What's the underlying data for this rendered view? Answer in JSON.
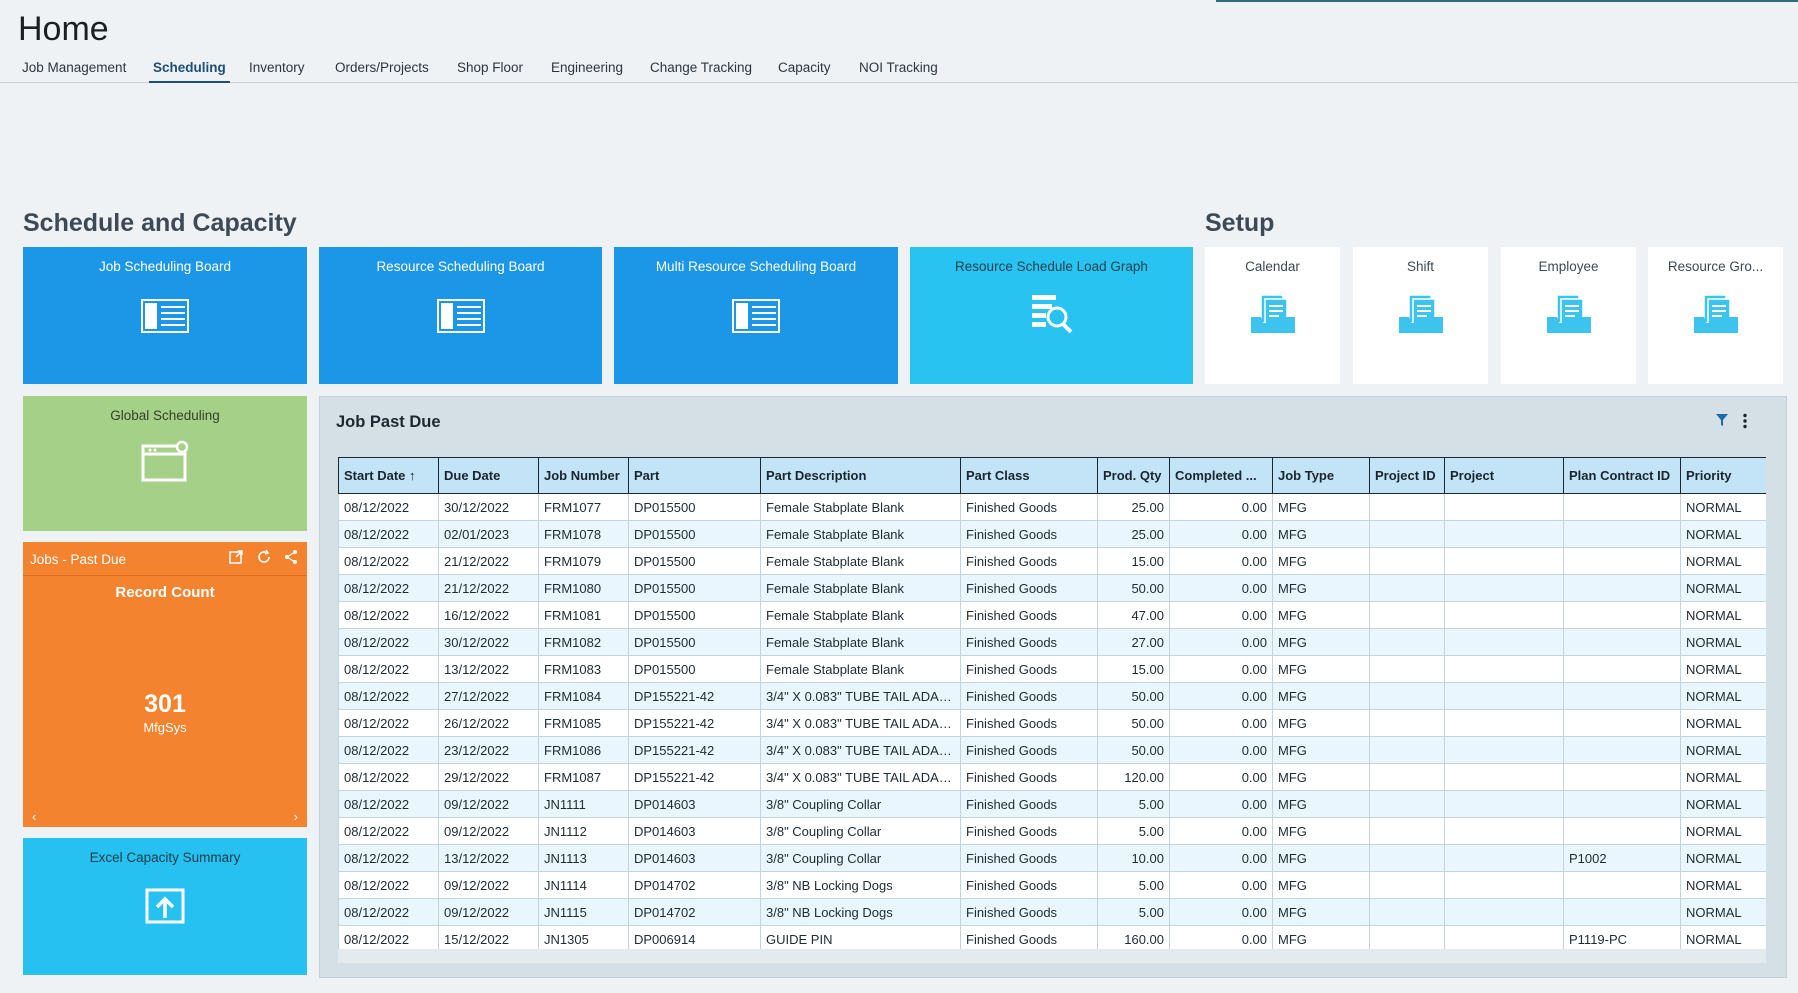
{
  "page": {
    "title": "Home"
  },
  "tabs": [
    {
      "label": "Job Management"
    },
    {
      "label": "Scheduling"
    },
    {
      "label": "Inventory"
    },
    {
      "label": "Orders/Projects"
    },
    {
      "label": "Shop Floor"
    },
    {
      "label": "Engineering"
    },
    {
      "label": "Change Tracking"
    },
    {
      "label": "Capacity"
    },
    {
      "label": "NOI Tracking"
    }
  ],
  "sections": {
    "schedule": "Schedule and Capacity",
    "setup": "Setup"
  },
  "tiles": {
    "job_board": "Job Scheduling Board",
    "resource_board": "Resource Scheduling Board",
    "multi_resource_board": "Multi Resource Scheduling Board",
    "load_graph": "Resource Schedule Load Graph",
    "calendar": "Calendar",
    "shift": "Shift",
    "employee": "Employee",
    "resource_group": "Resource Gro...",
    "global_scheduling": "Global Scheduling",
    "excel_capacity": "Excel Capacity Summary"
  },
  "kpi": {
    "title": "Jobs - Past Due",
    "subtitle": "Record Count",
    "value": "301",
    "unit": "MfgSys",
    "prev": "‹",
    "next": "›"
  },
  "grid": {
    "title": "Job Past Due",
    "columns": [
      "Start Date ↑",
      "Due Date",
      "Job Number",
      "Part",
      "Part Description",
      "Part Class",
      "Prod. Qty",
      "Completed ...",
      "Job Type",
      "Project ID",
      "Project",
      "Plan Contract ID",
      "Priority"
    ],
    "rows": [
      [
        "08/12/2022",
        "30/12/2022",
        "FRM1077",
        "DP015500",
        "Female Stabplate Blank",
        "Finished Goods",
        "25.00",
        "0.00",
        "MFG",
        "",
        "",
        "",
        "NORMAL"
      ],
      [
        "08/12/2022",
        "02/01/2023",
        "FRM1078",
        "DP015500",
        "Female Stabplate Blank",
        "Finished Goods",
        "25.00",
        "0.00",
        "MFG",
        "",
        "",
        "",
        "NORMAL"
      ],
      [
        "08/12/2022",
        "21/12/2022",
        "FRM1079",
        "DP015500",
        "Female Stabplate Blank",
        "Finished Goods",
        "15.00",
        "0.00",
        "MFG",
        "",
        "",
        "",
        "NORMAL"
      ],
      [
        "08/12/2022",
        "21/12/2022",
        "FRM1080",
        "DP015500",
        "Female Stabplate Blank",
        "Finished Goods",
        "50.00",
        "0.00",
        "MFG",
        "",
        "",
        "",
        "NORMAL"
      ],
      [
        "08/12/2022",
        "16/12/2022",
        "FRM1081",
        "DP015500",
        "Female Stabplate Blank",
        "Finished Goods",
        "47.00",
        "0.00",
        "MFG",
        "",
        "",
        "",
        "NORMAL"
      ],
      [
        "08/12/2022",
        "30/12/2022",
        "FRM1082",
        "DP015500",
        "Female Stabplate Blank",
        "Finished Goods",
        "27.00",
        "0.00",
        "MFG",
        "",
        "",
        "",
        "NORMAL"
      ],
      [
        "08/12/2022",
        "13/12/2022",
        "FRM1083",
        "DP015500",
        "Female Stabplate Blank",
        "Finished Goods",
        "15.00",
        "0.00",
        "MFG",
        "",
        "",
        "",
        "NORMAL"
      ],
      [
        "08/12/2022",
        "27/12/2022",
        "FRM1084",
        "DP155221-42",
        "3/4\" X 0.083\" TUBE TAIL ADAP...",
        "Finished Goods",
        "50.00",
        "0.00",
        "MFG",
        "",
        "",
        "",
        "NORMAL"
      ],
      [
        "08/12/2022",
        "26/12/2022",
        "FRM1085",
        "DP155221-42",
        "3/4\" X 0.083\" TUBE TAIL ADAP...",
        "Finished Goods",
        "50.00",
        "0.00",
        "MFG",
        "",
        "",
        "",
        "NORMAL"
      ],
      [
        "08/12/2022",
        "23/12/2022",
        "FRM1086",
        "DP155221-42",
        "3/4\" X 0.083\" TUBE TAIL ADAP...",
        "Finished Goods",
        "50.00",
        "0.00",
        "MFG",
        "",
        "",
        "",
        "NORMAL"
      ],
      [
        "08/12/2022",
        "29/12/2022",
        "FRM1087",
        "DP155221-42",
        "3/4\" X 0.083\" TUBE TAIL ADAP...",
        "Finished Goods",
        "120.00",
        "0.00",
        "MFG",
        "",
        "",
        "",
        "NORMAL"
      ],
      [
        "08/12/2022",
        "09/12/2022",
        "JN1111",
        "DP014603",
        "3/8\" Coupling Collar",
        "Finished Goods",
        "5.00",
        "0.00",
        "MFG",
        "",
        "",
        "",
        "NORMAL"
      ],
      [
        "08/12/2022",
        "09/12/2022",
        "JN1112",
        "DP014603",
        "3/8\" Coupling Collar",
        "Finished Goods",
        "5.00",
        "0.00",
        "MFG",
        "",
        "",
        "",
        "NORMAL"
      ],
      [
        "08/12/2022",
        "13/12/2022",
        "JN1113",
        "DP014603",
        "3/8\" Coupling Collar",
        "Finished Goods",
        "10.00",
        "0.00",
        "MFG",
        "",
        "",
        "P1002",
        "NORMAL"
      ],
      [
        "08/12/2022",
        "09/12/2022",
        "JN1114",
        "DP014702",
        "3/8\" NB Locking Dogs",
        "Finished Goods",
        "5.00",
        "0.00",
        "MFG",
        "",
        "",
        "",
        "NORMAL"
      ],
      [
        "08/12/2022",
        "09/12/2022",
        "JN1115",
        "DP014702",
        "3/8\" NB Locking Dogs",
        "Finished Goods",
        "5.00",
        "0.00",
        "MFG",
        "",
        "",
        "",
        "NORMAL"
      ],
      [
        "08/12/2022",
        "15/12/2022",
        "JN1305",
        "DP006914",
        "GUIDE PIN",
        "Finished Goods",
        "160.00",
        "0.00",
        "MFG",
        "",
        "",
        "P1119-PC",
        "NORMAL"
      ]
    ]
  },
  "colors": {
    "tile_blue": "#1c96e6",
    "tile_lightblue": "#28c3f1",
    "tile_green": "#a4d187",
    "tile_orange": "#f3832e",
    "header_blue": "#c3e3f6",
    "accent": "#1d4f75"
  },
  "icons": {
    "board": "board-icon",
    "load_graph": "search-report-icon",
    "setup": "document-stack-icon",
    "global": "calendar-gear-icon",
    "excel": "upload-icon",
    "filter": "filter-icon",
    "more": "more-vertical-icon"
  }
}
